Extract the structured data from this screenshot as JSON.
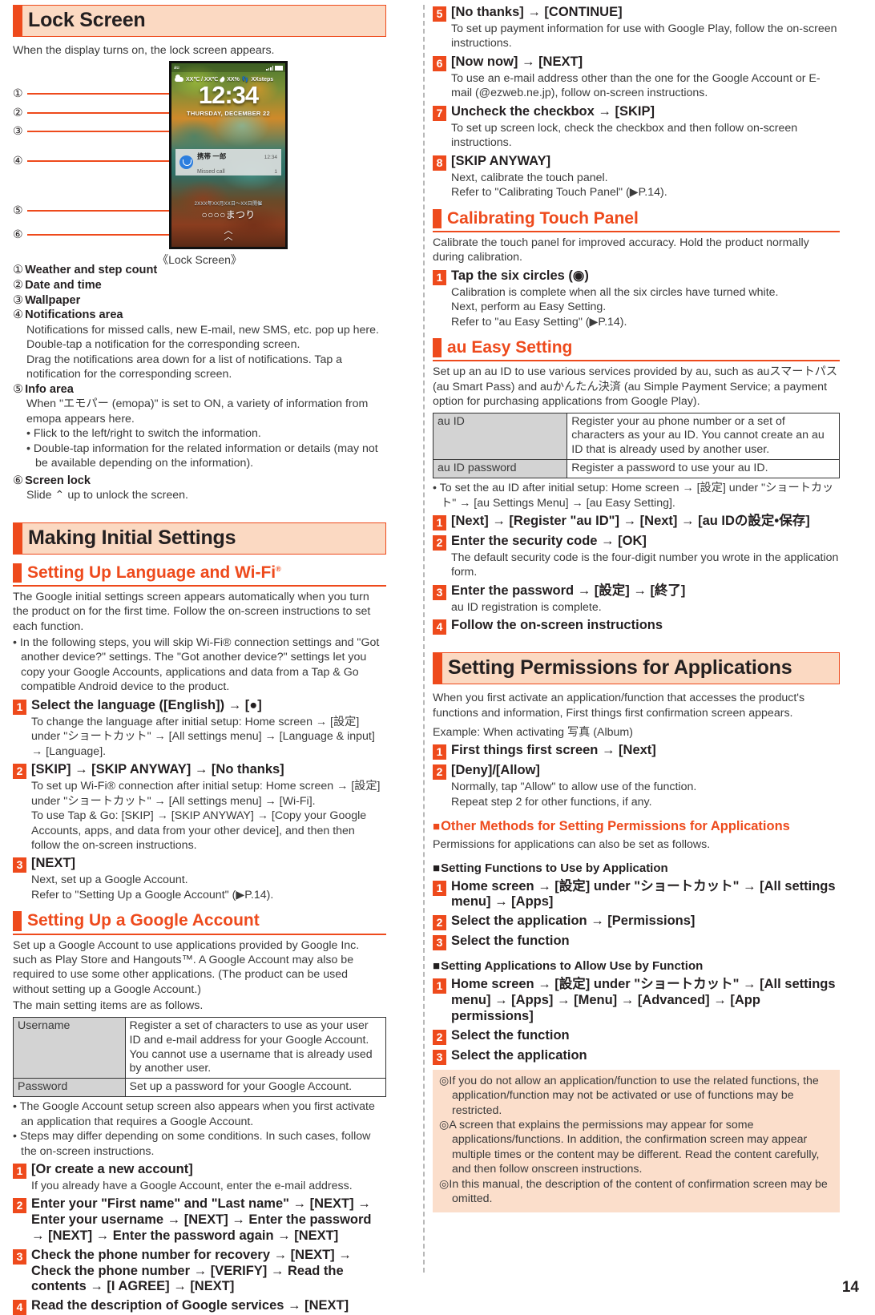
{
  "page_number": "14",
  "left": {
    "section_lock": {
      "title": "Lock Screen",
      "intro": "When the display turns on, the lock screen appears.",
      "figure_caption": "《Lock Screen》",
      "phone": {
        "carrier": "au",
        "weather_temps": "XX℃ / XX℃",
        "humidity": "XX%",
        "steps": "XXsteps",
        "time": "12:34",
        "date": "THURSDAY, DECEMBER 22",
        "notification_name": "携帯 一郎",
        "notification_text": "Missed call",
        "notification_time": "12:34",
        "notification_count": "1",
        "info_small": "2XXX年XX月XX日〜XX日開催",
        "info_large": "○○○○まつり",
        "unlock_chevron": "unlock-chevron"
      },
      "callouts": [
        {
          "num": "①",
          "label": "Weather and step count"
        },
        {
          "num": "②",
          "label": "Date and time"
        },
        {
          "num": "③",
          "label": "Wallpaper"
        },
        {
          "num": "④",
          "label": "Notifications area"
        },
        {
          "num": "⑤",
          "label": "Info area"
        },
        {
          "num": "⑥",
          "label": "Screen lock"
        }
      ],
      "legend": [
        {
          "num": "①",
          "head": "Weather and step count",
          "body": [],
          "bullets": []
        },
        {
          "num": "②",
          "head": "Date and time",
          "body": [],
          "bullets": []
        },
        {
          "num": "③",
          "head": "Wallpaper",
          "body": [],
          "bullets": []
        },
        {
          "num": "④",
          "head": "Notifications area",
          "body": [
            "Notifications for missed calls, new E-mail, new SMS, etc. pop up here. Double-tap a notification for the corresponding screen.",
            "Drag the notifications area down for a list of notifications. Tap a notification for the corresponding screen."
          ],
          "bullets": []
        },
        {
          "num": "⑤",
          "head": "Info area",
          "body": [
            "When \"エモパー (emopa)\" is set to ON, a variety of information from emopa appears here."
          ],
          "bullets": [
            "Flick to the left/right to switch the information.",
            "Double-tap information for the related information or details (may not be available depending on the information)."
          ]
        },
        {
          "num": "⑥",
          "head": "Screen lock",
          "body": [
            "Slide ⌃ up to unlock the screen."
          ],
          "bullets": []
        }
      ]
    },
    "section_initial": {
      "title": "Making Initial Settings",
      "sub_language": {
        "title": "Setting Up Language and Wi-Fi",
        "title_sup": "®",
        "intro": "The Google initial settings screen appears automatically when you turn the product on for the first time. Follow the on-screen instructions to set each function.",
        "bullets": [
          "In the following steps, you will skip Wi-Fi® connection settings and \"Got another device?\" settings. The \"Got another device?\" settings let you copy your Google Accounts, applications and data from a Tap & Go compatible Android device to the product."
        ],
        "steps": [
          {
            "num": "1",
            "title": "Select the language ([English]) → [●]",
            "body": [
              "To change the language after initial setup: Home screen → [設定] under \"ショートカット\" → [All settings menu] → [Language & input] → [Language]."
            ]
          },
          {
            "num": "2",
            "title": "[SKIP] → [SKIP ANYWAY] → [No thanks]",
            "body": [
              "To set up Wi-Fi® connection after initial setup: Home screen → [設定] under \"ショートカット\" → [All settings menu] → [Wi-Fi].",
              "To use Tap & Go: [SKIP] → [SKIP ANYWAY] → [Copy your Google Accounts, apps, and data from your other device], and then then follow the on-screen instructions."
            ]
          },
          {
            "num": "3",
            "title": "[NEXT]",
            "body": [
              "Next, set up a Google Account.",
              "Refer to \"Setting Up a Google Account\" (▶P.14)."
            ]
          }
        ]
      },
      "sub_google": {
        "title": "Setting Up a Google Account",
        "intro1": "Set up a Google Account to use applications provided by Google Inc. such as Play Store and Hangouts™. A Google Account may also be required to use some other applications. (The product can be used without setting up a Google Account.)",
        "intro2": "The main setting items are as follows.",
        "table": [
          {
            "key": "Username",
            "value": "Register a set of characters to use as your user ID and e-mail address for your Google Account. You cannot use a username that is already used by another user."
          },
          {
            "key": "Password",
            "value": "Set up a password for your Google Account."
          }
        ],
        "bullets": [
          "The Google Account setup screen also appears when you first activate an application that requires a Google Account.",
          "Steps may differ depending on some conditions. In such cases, follow the on-screen instructions."
        ],
        "steps": [
          {
            "num": "1",
            "title": "[Or create a new account]",
            "body": [
              "If you already have a Google Account, enter the e-mail address."
            ]
          },
          {
            "num": "2",
            "title": "Enter your \"First name\" and \"Last name\" → [NEXT] → Enter your username → [NEXT] → Enter the password → [NEXT] → Enter the password again → [NEXT]",
            "body": []
          },
          {
            "num": "3",
            "title": "Check the phone number for recovery → [NEXT] → Check the phone number → [VERIFY] → Read the contents → [I AGREE] → [NEXT]",
            "body": []
          },
          {
            "num": "4",
            "title": "Read the description of Google services → [NEXT]",
            "body": []
          }
        ]
      }
    }
  },
  "right": {
    "continued_steps": [
      {
        "num": "5",
        "title": "[No thanks] → [CONTINUE]",
        "body": [
          "To set up payment information for use with Google Play, follow the on-screen instructions."
        ]
      },
      {
        "num": "6",
        "title": "[Now now] → [NEXT]",
        "body": [
          "To use an e-mail address other than the one for the Google Account or E-mail (@ezweb.ne.jp), follow on-screen instructions."
        ]
      },
      {
        "num": "7",
        "title": "Uncheck the checkbox → [SKIP]",
        "body": [
          "To set up screen lock, check the checkbox and then follow on-screen instructions."
        ]
      },
      {
        "num": "8",
        "title": "[SKIP ANYWAY]",
        "body": [
          "Next, calibrate the touch panel.",
          "Refer to \"Calibrating Touch Panel\" (▶P.14)."
        ]
      }
    ],
    "section_calibrate": {
      "title": "Calibrating Touch Panel",
      "intro": "Calibrate the touch panel for improved accuracy. Hold the product normally during calibration.",
      "steps": [
        {
          "num": "1",
          "title": "Tap the six circles (◉)",
          "body": [
            "Calibration is complete when all the six circles have turned white.",
            "Next, perform au Easy Setting.",
            "Refer to \"au Easy Setting\" (▶P.14)."
          ]
        }
      ]
    },
    "section_au": {
      "title": "au Easy Setting",
      "intro": "Set up an au ID to use various services provided by au, such as auスマートパス (au Smart Pass) and auかんたん決済 (au Simple Payment Service; a payment option for purchasing applications from Google Play).",
      "table": [
        {
          "key": "au ID",
          "value": "Register your au phone number or a set of characters as your au ID. You cannot create an au ID that is already used by another user."
        },
        {
          "key": "au ID password",
          "value": "Register a password to use your au ID."
        }
      ],
      "bullets": [
        "To set the au ID after initial setup: Home screen → [設定] under \"ショートカット\" → [au Settings Menu] → [au Easy Setting]."
      ],
      "steps": [
        {
          "num": "1",
          "title": "[Next] → [Register \"au ID\"] → [Next] → [au IDの設定•保存]",
          "body": []
        },
        {
          "num": "2",
          "title": "Enter the security code → [OK]",
          "body": [
            "The default security code is the four-digit number you wrote in the application form."
          ]
        },
        {
          "num": "3",
          "title": "Enter the password → [設定] → [終了]",
          "body": [
            "au ID registration is complete."
          ]
        },
        {
          "num": "4",
          "title": "Follow the on-screen instructions",
          "body": []
        }
      ]
    },
    "section_permissions": {
      "title": "Setting Permissions for Applications",
      "intro": "When you first activate an application/function that accesses the product's functions and information, First things first confirmation screen appears.",
      "example": "Example: When activating 写真 (Album)",
      "steps": [
        {
          "num": "1",
          "title": "First things first screen → [Next]",
          "body": []
        },
        {
          "num": "2",
          "title": "[Deny]/[Allow]",
          "body": [
            "Normally, tap \"Allow\" to allow use of the function.",
            "Repeat step 2 for other functions, if any."
          ]
        }
      ],
      "other_methods": {
        "title": "Other Methods for Setting Permissions for Applications",
        "intro": "Permissions for applications can also be set as follows.",
        "groups": [
          {
            "title": "Setting Functions to Use by Application",
            "steps": [
              {
                "num": "1",
                "title": "Home screen → [設定] under \"ショートカット\" → [All settings menu] → [Apps]"
              },
              {
                "num": "2",
                "title": "Select the application → [Permissions]"
              },
              {
                "num": "3",
                "title": "Select the function"
              }
            ]
          },
          {
            "title": "Setting Applications to Allow Use by Function",
            "steps": [
              {
                "num": "1",
                "title": "Home screen → [設定] under \"ショートカット\" → [All settings menu] → [Apps] → [Menu] → [Advanced] → [App permissions]"
              },
              {
                "num": "2",
                "title": "Select the function"
              },
              {
                "num": "3",
                "title": "Select the application"
              }
            ]
          }
        ]
      },
      "notes": [
        "If you do not allow an application/function to use the related functions, the application/function may not be activated or use of functions may be restricted.",
        "A screen that explains the permissions may appear for some applications/functions. In addition, the confirmation screen may appear multiple times or the content may be different. Read the content carefully, and then follow onscreen instructions.",
        "In this manual, the description of the content of confirmation screen may be omitted."
      ],
      "note_marker": "◎"
    }
  },
  "colors": {
    "accent": "#ee4a1c",
    "header_bg": "#fbd9c2",
    "note_bg": "#fbdecb",
    "table_key_bg": "#d3d3d3"
  }
}
